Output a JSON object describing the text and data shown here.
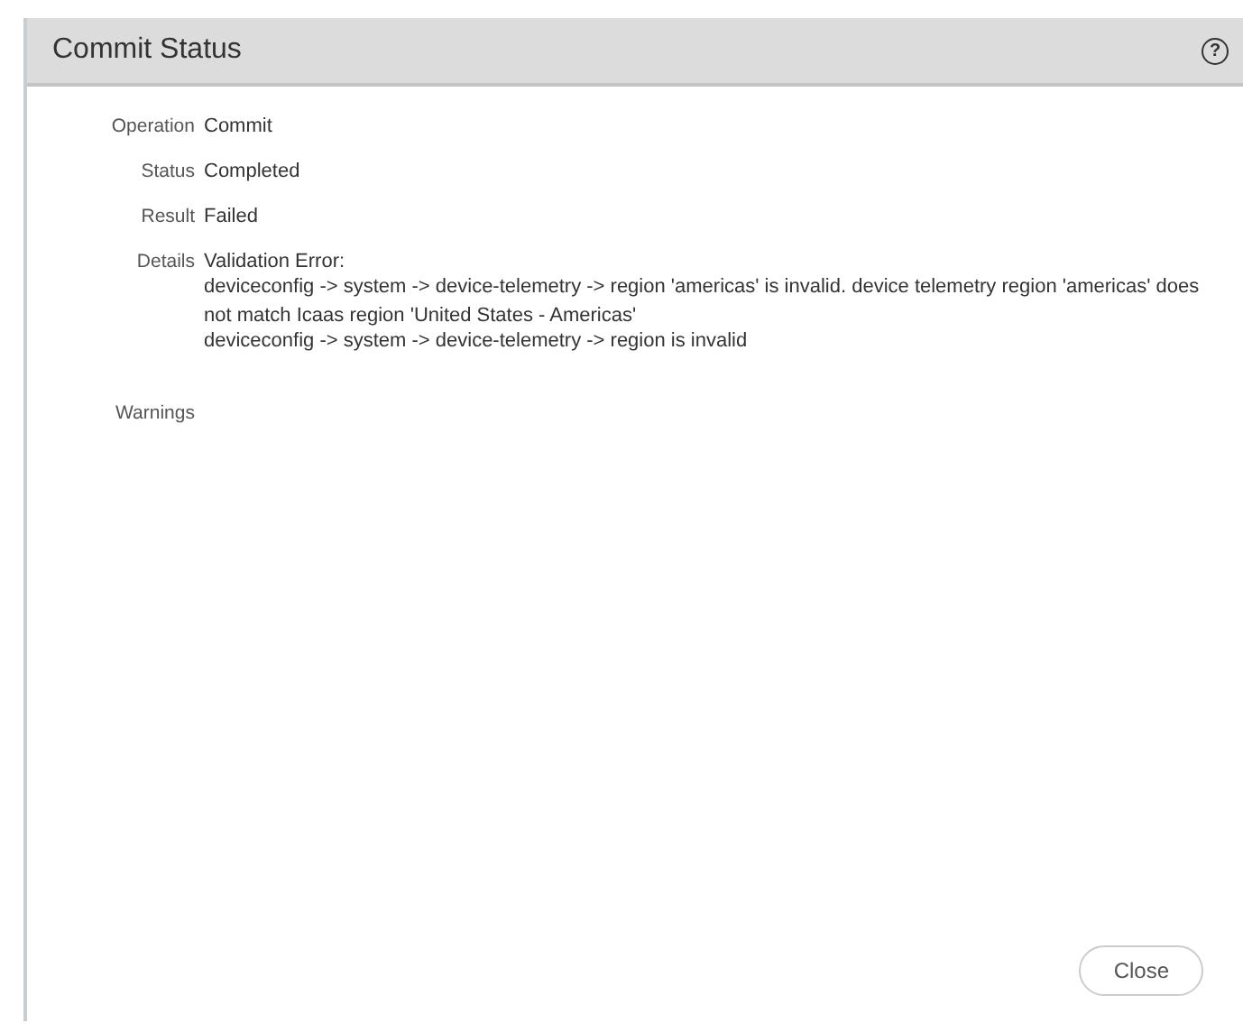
{
  "dialog": {
    "title": "Commit Status",
    "help_icon": "?"
  },
  "fields": [
    {
      "label": "Operation",
      "lines": [
        "Commit"
      ]
    },
    {
      "label": "Status",
      "lines": [
        "Completed"
      ]
    },
    {
      "label": "Result",
      "lines": [
        "Failed"
      ]
    },
    {
      "label": "Details",
      "lines": [
        "Validation Error:",
        "deviceconfig -> system -> device-telemetry -> region 'americas' is invalid. device telemetry region 'americas' does not match Icaas region 'United States - Americas'",
        "deviceconfig -> system -> device-telemetry -> region is invalid"
      ]
    }
  ],
  "warnings": {
    "label": "Warnings"
  },
  "buttons": [
    "Close"
  ]
}
